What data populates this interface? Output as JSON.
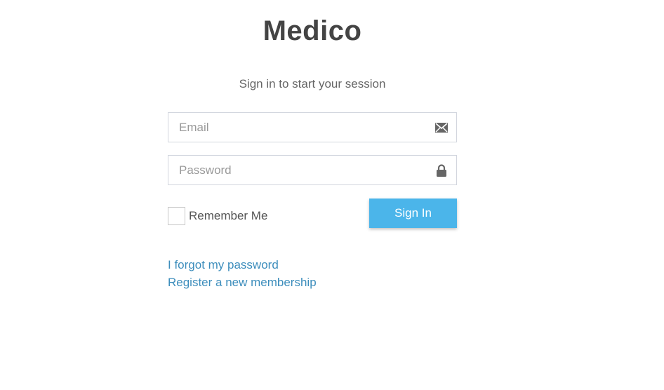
{
  "brand": {
    "name": "Medico"
  },
  "login": {
    "message": "Sign in to start your session",
    "email": {
      "placeholder": "Email",
      "value": "",
      "icon": "envelope-icon"
    },
    "password": {
      "placeholder": "Password",
      "value": "",
      "icon": "lock-icon"
    },
    "remember_label": "Remember Me",
    "remember_checked": false,
    "submit_label": "Sign In",
    "forgot_link": "I forgot my password",
    "register_link": "Register a new membership"
  },
  "colors": {
    "button": "#4bb5ea",
    "link": "#3c8dbc",
    "logo_text": "#444444"
  }
}
